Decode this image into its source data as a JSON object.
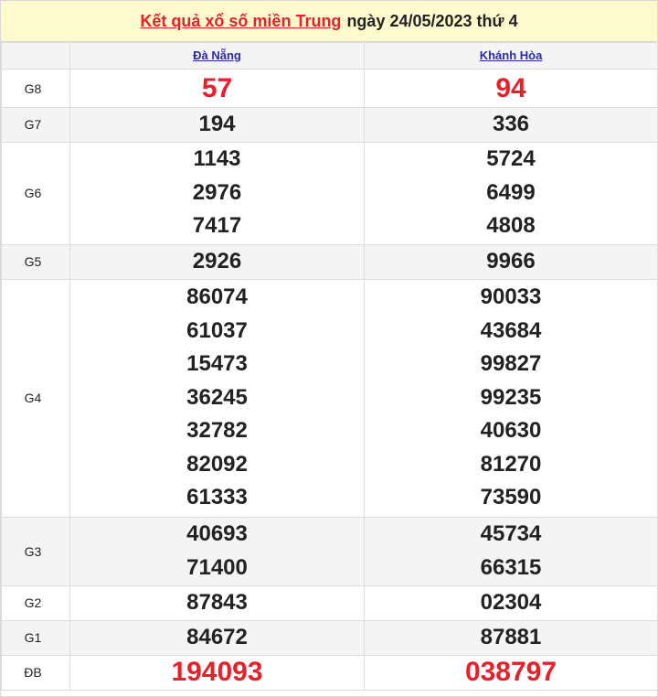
{
  "header": {
    "title_link": "Kết quả xổ số miền Trung",
    "title_rest": "ngày 24/05/2023 thứ 4"
  },
  "provinces": [
    "Đà Nẵng",
    "Khánh Hòa"
  ],
  "prizes": [
    {
      "label": "G8",
      "col1": [
        "57"
      ],
      "col2": [
        "94"
      ]
    },
    {
      "label": "G7",
      "col1": [
        "194"
      ],
      "col2": [
        "336"
      ]
    },
    {
      "label": "G6",
      "col1": [
        "1143",
        "2976",
        "7417"
      ],
      "col2": [
        "5724",
        "6499",
        "4808"
      ]
    },
    {
      "label": "G5",
      "col1": [
        "2926"
      ],
      "col2": [
        "9966"
      ]
    },
    {
      "label": "G4",
      "col1": [
        "86074",
        "61037",
        "15473",
        "36245",
        "32782",
        "82092",
        "61333"
      ],
      "col2": [
        "90033",
        "43684",
        "99827",
        "99235",
        "40630",
        "81270",
        "73590"
      ]
    },
    {
      "label": "G3",
      "col1": [
        "40693",
        "71400"
      ],
      "col2": [
        "45734",
        "66315"
      ]
    },
    {
      "label": "G2",
      "col1": [
        "87843"
      ],
      "col2": [
        "02304"
      ]
    },
    {
      "label": "G1",
      "col1": [
        "84672"
      ],
      "col2": [
        "87881"
      ]
    },
    {
      "label": "ĐB",
      "col1": [
        "194093"
      ],
      "col2": [
        "038797"
      ]
    }
  ]
}
